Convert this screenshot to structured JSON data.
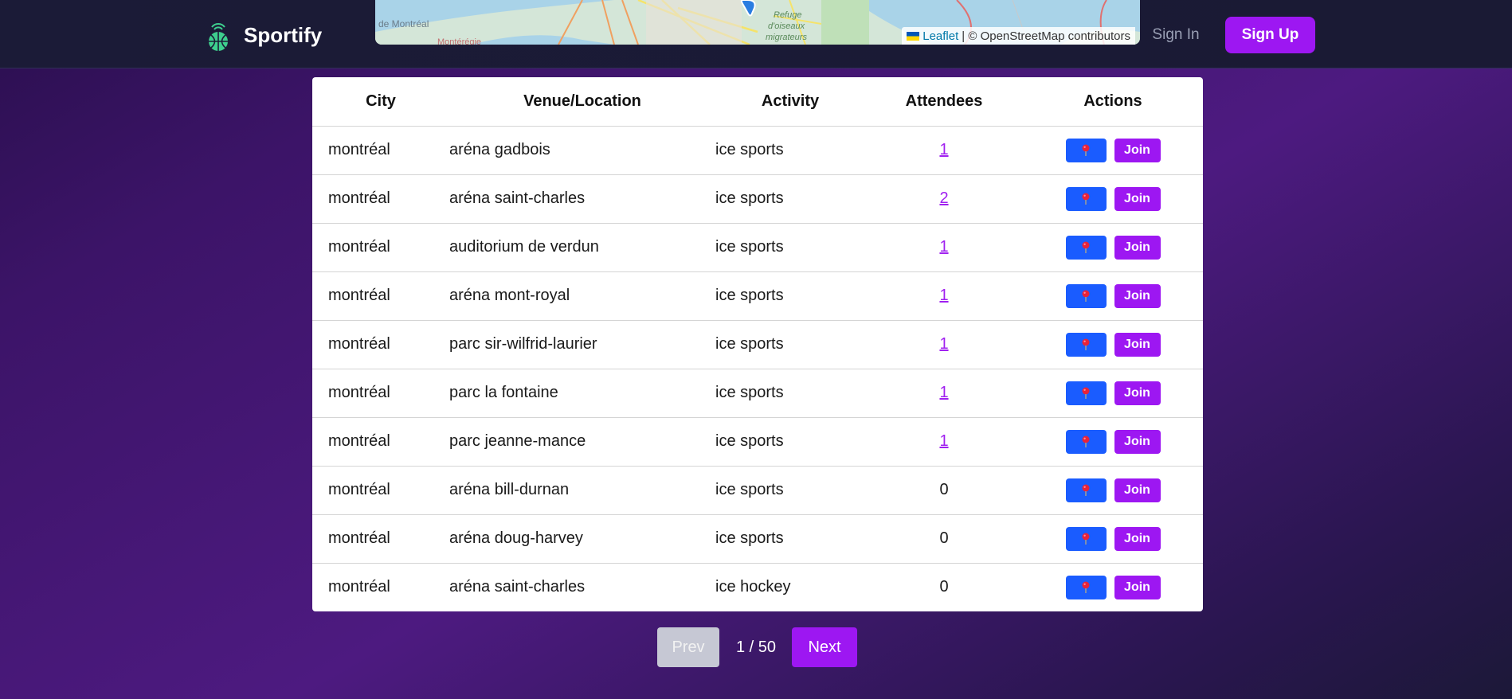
{
  "brand": {
    "name": "Sportify",
    "icon": "basketball-signal-icon"
  },
  "map": {
    "labels": [
      "de Montréal",
      "Montérégie",
      "Refuge",
      "d'oiseaux",
      "migrateurs"
    ],
    "attribution_link": "Leaflet",
    "attribution_text": "| © OpenStreetMap contributors"
  },
  "nav": {
    "signin_label": "Sign In",
    "signup_label": "Sign Up"
  },
  "table": {
    "headers": [
      "City",
      "Venue/Location",
      "Activity",
      "Attendees",
      "Actions"
    ],
    "rows": [
      {
        "city": "montréal",
        "venue": "aréna gadbois",
        "activity": "ice sports",
        "attendees": "1",
        "link": true
      },
      {
        "city": "montréal",
        "venue": "aréna saint-charles",
        "activity": "ice sports",
        "attendees": "2",
        "link": true
      },
      {
        "city": "montréal",
        "venue": "auditorium de verdun",
        "activity": "ice sports",
        "attendees": "1",
        "link": true
      },
      {
        "city": "montréal",
        "venue": "aréna mont-royal",
        "activity": "ice sports",
        "attendees": "1",
        "link": true
      },
      {
        "city": "montréal",
        "venue": "parc sir-wilfrid-laurier",
        "activity": "ice sports",
        "attendees": "1",
        "link": true
      },
      {
        "city": "montréal",
        "venue": "parc la fontaine",
        "activity": "ice sports",
        "attendees": "1",
        "link": true
      },
      {
        "city": "montréal",
        "venue": "parc jeanne-mance",
        "activity": "ice sports",
        "attendees": "1",
        "link": true
      },
      {
        "city": "montréal",
        "venue": "aréna bill-durnan",
        "activity": "ice sports",
        "attendees": "0",
        "link": false
      },
      {
        "city": "montréal",
        "venue": "aréna doug-harvey",
        "activity": "ice sports",
        "attendees": "0",
        "link": false
      },
      {
        "city": "montréal",
        "venue": "aréna saint-charles",
        "activity": "ice hockey",
        "attendees": "0",
        "link": false
      }
    ],
    "join_label": "Join",
    "pin_icon": "map-pin-icon"
  },
  "pagination": {
    "prev_label": "Prev",
    "indicator": "1 / 50",
    "next_label": "Next"
  },
  "colors": {
    "accent": "#9d17f2",
    "pin_button": "#1a5cff",
    "nav_bg": "#1b1b37"
  }
}
